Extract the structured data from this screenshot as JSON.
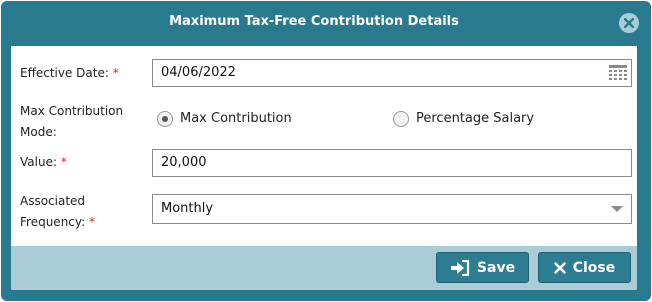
{
  "dialog": {
    "title": "Maximum Tax-Free Contribution Details",
    "close_icon": "close-circle-icon"
  },
  "form": {
    "effective_date": {
      "label": "Effective Date:",
      "required_marker": "*",
      "value": "04/06/2022",
      "icon": "calendar-icon"
    },
    "mode": {
      "label_line1": "Max Contribution",
      "label_line2": "Mode:",
      "options": [
        {
          "label": "Max Contribution",
          "selected": true
        },
        {
          "label": "Percentage Salary",
          "selected": false
        }
      ]
    },
    "value": {
      "label": "Value:",
      "required_marker": "*",
      "value": "20,000"
    },
    "frequency": {
      "label_line1": "Associated",
      "label_line2": "Frequency:",
      "required_marker": "*",
      "selected": "Monthly"
    }
  },
  "footer": {
    "save_label": "Save",
    "save_icon": "sign-in-icon",
    "close_label": "Close",
    "close_icon": "close-icon"
  },
  "colors": {
    "frame": "#2a7a8f",
    "footer": "#a9ccd6",
    "button": "#2d7d92",
    "required": "#e02020"
  }
}
